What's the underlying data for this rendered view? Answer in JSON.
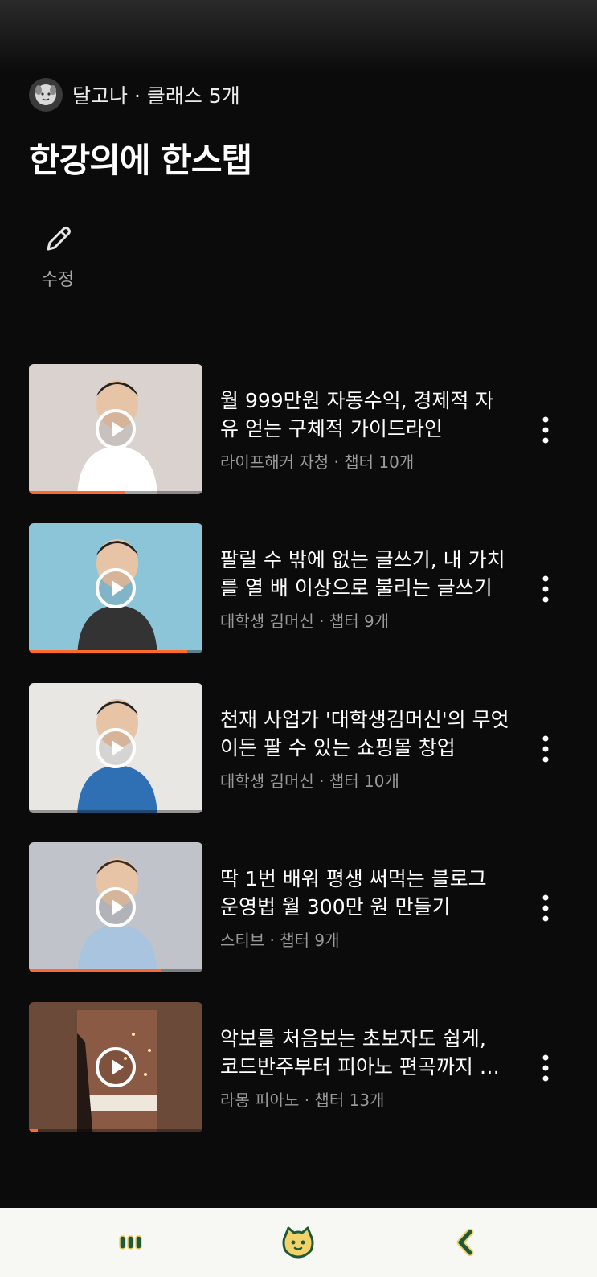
{
  "header": {
    "owner_name": "달고나",
    "owner_suffix": " · 클래스 5개",
    "title": "한강의에 한스탭",
    "edit_label": "수정"
  },
  "courses": [
    {
      "title": "월 999만원 자동수익, 경제적 자유 얻는 구체적 가이드라인",
      "author": "라이프해커 자청",
      "chapters": " · 챕터 10개",
      "progress": 0.55,
      "thumb_bg": "#d9d2cf",
      "person_color": "#f4f4f4"
    },
    {
      "title": "팔릴 수 밖에 없는 글쓰기, 내 가치를 열 배 이상으로 불리는 글쓰기",
      "author": "대학생 김머신",
      "chapters": " · 챕터 9개",
      "progress": 0.91,
      "thumb_bg": "#8cc4d8",
      "person_color": "#2a2d33"
    },
    {
      "title": "천재 사업가 '대학생김머신'의 무엇이든 팔 수 있는 쇼핑몰 창업",
      "author": "대학생 김머신",
      "chapters": " · 챕터 10개",
      "progress": 0,
      "thumb_bg": "#e9e7e4",
      "person_color": "#2f6fb3"
    },
    {
      "title": "딱 1번 배워 평생 써먹는 블로그 운영법 월 300만 원 만들기",
      "author": "스티브",
      "chapters": " · 챕터 9개",
      "progress": 0.76,
      "thumb_bg": "#c0c3c9",
      "person_color": "#a9c4de"
    },
    {
      "title": "악보를 처음보는 초보자도 쉽게, 코드반주부터 피아노 편곡까지 배우기",
      "author": "라몽 피아노",
      "chapters": " · 챕터 13개",
      "progress": 0.05,
      "thumb_bg": "#6b4a3a",
      "person_color": "#2a1f1a"
    }
  ],
  "colors": {
    "accent": "#ff6a2b",
    "nav_icon": "#1e5a3a",
    "nav_mascot": "#f1d36a"
  },
  "nav": {
    "items": [
      "library-icon",
      "mascot-home-icon",
      "back-icon"
    ]
  }
}
